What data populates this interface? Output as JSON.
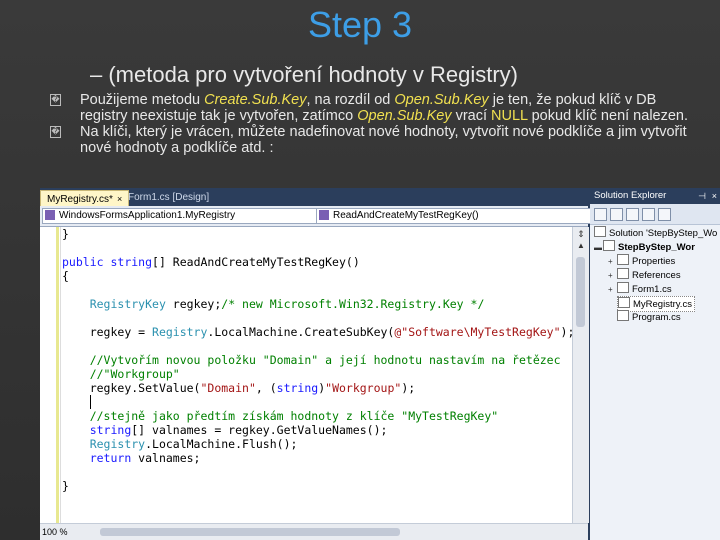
{
  "slide": {
    "title": "Step 3",
    "subtitle": "– (metoda pro vytvoření hodnoty v Registry)",
    "bullet_marker": "�",
    "bullet1": {
      "p1": "Použijeme metodu ",
      "m1": "Create.Sub.Key",
      "p2": ", na rozdíl od  ",
      "m2": "Open.Sub.Key",
      "p3": " je ten, že pokud klíč v DB registry neexistuje tak je vytvořen, zatímco ",
      "m3": "Open.Sub.Key",
      "p4": " vrací ",
      "m4": "NULL",
      "p5": " pokud klíč není nalezen."
    },
    "bullet2": "Na klíči, který je vrácen, můžete nadefinovat nové hodnoty, vytvořit nové podklíče a jim vytvořit nové hodnoty a podklíče atd. :"
  },
  "ide": {
    "tabs": [
      {
        "label": "MyRegistry.cs*",
        "close": "×",
        "active": true
      },
      {
        "label": "Form1.cs [Design]",
        "active": false
      }
    ],
    "left_combo": "WindowsFormsApplication1.MyRegistry",
    "right_combo": "ReadAndCreateMyTestRegKey()",
    "zoom": "100 %",
    "code": {
      "l1": "}",
      "l2_kw": "public",
      "l2_ty": "string",
      "l2_rest": "[] ReadAndCreateMyTestRegKey()",
      "l3": "{",
      "l4_ty": "RegistryKey",
      "l4_rest": " regkey;",
      "l4_cm": "/* new Microsoft.Win32.Registry.Key */",
      "l5_a": "regkey = ",
      "l5_ty": "Registry",
      "l5_b": ".LocalMachine.CreateSubKey(",
      "l5_st": "@\"Software\\MyTestRegKey\"",
      "l5_c": ");",
      "l6_cm": "//Vytvořím novou položku \"Domain\" a její hodnotu nastavím na řetězec",
      "l7_cm": "//\"Workgroup\"",
      "l8_a": "regkey.SetValue(",
      "l8_st1": "\"Domain\"",
      "l8_b": ", (",
      "l8_kw": "string",
      "l8_c": ")",
      "l8_st2": "\"Workgroup\"",
      "l8_d": ");",
      "l10_cm": "//stejně jako předtím získám hodnoty z klíče \"MyTestRegKey\"",
      "l11_kw": "string",
      "l11_rest": "[] valnames = regkey.GetValueNames();",
      "l12_ty": "Registry",
      "l12_rest": ".LocalMachine.Flush();",
      "l13_kw": "return",
      "l13_rest": " valnames;",
      "l14": "}"
    },
    "solution_explorer": {
      "title": "Solution Explorer",
      "pin": "⊣",
      "close": "×",
      "items": [
        {
          "label": "Solution 'StepByStep_Wo",
          "expander": ""
        },
        {
          "label": "StepByStep_Wor",
          "expander": "▬",
          "bold": true
        },
        {
          "label": "Properties",
          "expander": "+"
        },
        {
          "label": "References",
          "expander": "+"
        },
        {
          "label": "Form1.cs",
          "expander": "+"
        },
        {
          "label": "MyRegistry.cs",
          "expander": "",
          "selected": true
        },
        {
          "label": "Program.cs",
          "expander": ""
        }
      ]
    }
  }
}
